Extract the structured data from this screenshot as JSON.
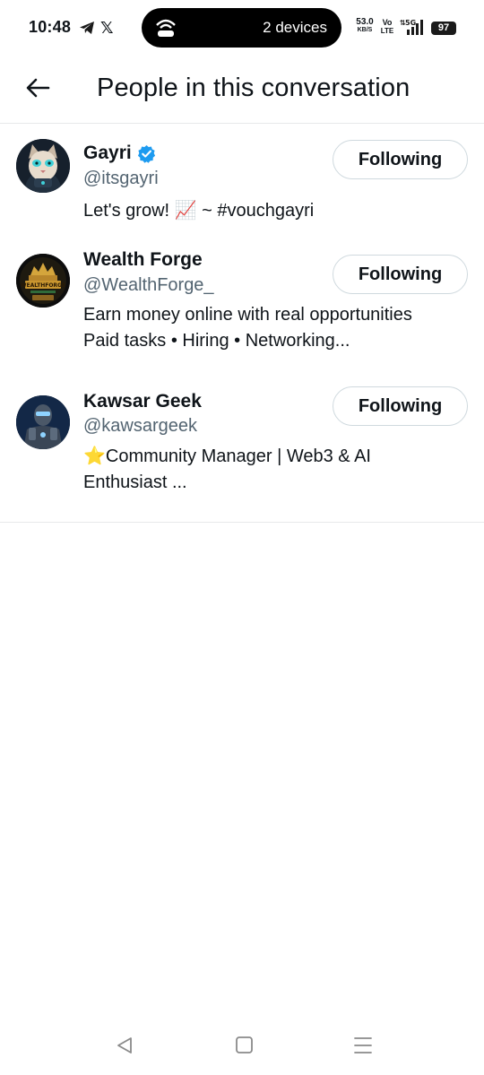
{
  "status_bar": {
    "time": "10:48",
    "pill_text": "2 devices",
    "net_speed": "53.0",
    "net_unit": "KB/S",
    "volte_top": "Vo",
    "volte_bottom": "LTE",
    "signal_label": "5G",
    "battery": "97"
  },
  "header": {
    "title": "People in this conversation"
  },
  "users": [
    {
      "name": "Gayri",
      "verified": true,
      "handle": "@itsgayri",
      "bio": "Let's grow! 📈 ~ #vouchgayri",
      "follow_label": "Following"
    },
    {
      "name": "Wealth Forge",
      "verified": false,
      "handle": "@WealthForge_",
      "bio": "Earn money online with real opportunities\nPaid tasks • Hiring • Networking...",
      "avatar_text": "WEALTHFORGE",
      "follow_label": "Following"
    },
    {
      "name": "Kawsar Geek",
      "verified": false,
      "handle": "@kawsargeek",
      "bio": "⭐Community Manager | Web3 & AI\nEnthusiast ...",
      "follow_label": "Following"
    }
  ],
  "colors": {
    "text_primary": "#0f1419",
    "text_secondary": "#536471",
    "verified_blue": "#1d9bf0",
    "divider": "#e7e9ea",
    "button_border": "#cfd9de"
  },
  "icons": {
    "back": "arrow-left-icon",
    "verified": "verified-badge-icon",
    "nav_back": "triangle-back-icon",
    "nav_home": "square-home-icon",
    "nav_recents": "menu-lines-icon"
  }
}
